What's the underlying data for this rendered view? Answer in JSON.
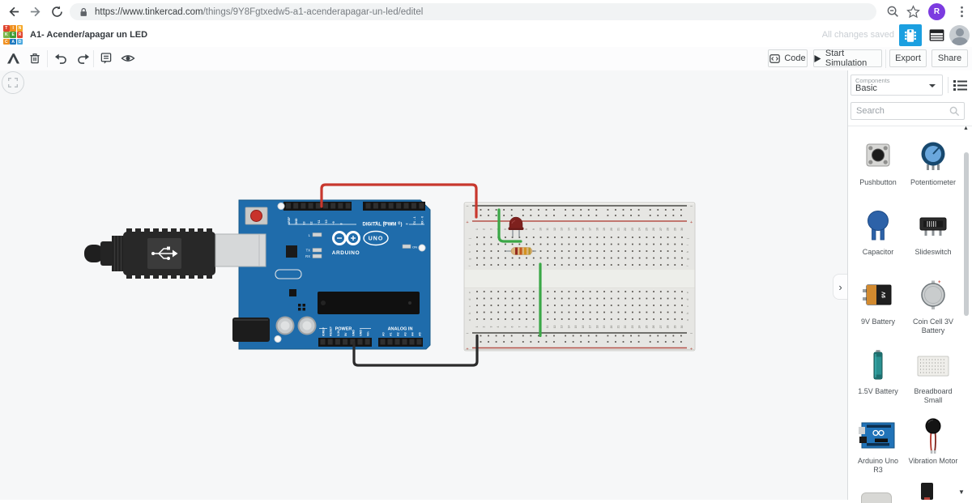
{
  "browser": {
    "url_domain": "https://www.tinkercad.com",
    "url_path": "/things/9Y8Fgtxedw5-a1-acenderapagar-un-led/editel",
    "avatar_letter": "R"
  },
  "header": {
    "logo_letters": [
      "T",
      "I",
      "N",
      "K",
      "E",
      "R",
      "C",
      "A",
      "D"
    ],
    "logo_colors": [
      "#e0452f",
      "#f09020",
      "#f5a623",
      "#7ab648",
      "#3f9c35",
      "#e0452f",
      "#f09020",
      "#1d78be",
      "#4aa8df"
    ],
    "title": "A1- Acender/apagar un LED",
    "save_status": "All changes saved"
  },
  "toolbar": {
    "code": "Code",
    "start_simulation": "Start Simulation",
    "export": "Export",
    "share": "Share"
  },
  "sidebar": {
    "components_label": "Components",
    "category": "Basic",
    "search_placeholder": "Search",
    "components": [
      {
        "label": "Pushbutton"
      },
      {
        "label": "Potentiometer"
      },
      {
        "label": "Capacitor"
      },
      {
        "label": "Slideswitch"
      },
      {
        "label": "9V Battery",
        "icon_text": "9V"
      },
      {
        "label": "Coin Cell 3V Battery"
      },
      {
        "label": "1.5V Battery"
      },
      {
        "label": "Breadboard Small"
      },
      {
        "label": "Arduino Uno R3"
      },
      {
        "label": "Vibration Motor"
      }
    ]
  },
  "circuit": {
    "arduino": {
      "brand": "ARDUINO",
      "model": "UNO",
      "digital_label": "DIGITAL (PWM ~)",
      "digital_pins_left": [
        "AREF",
        "GND",
        "13",
        "12",
        "~11",
        "~10",
        "~9",
        "8"
      ],
      "digital_pins_right": [
        "7",
        "~6",
        "~5",
        "4",
        "~3",
        "2",
        "TX→1",
        "RX←0"
      ],
      "power_label": "POWER",
      "power_pins": [
        "IOREF",
        "RESET",
        "3.3V",
        "5V",
        "GND",
        "GND",
        "Vin"
      ],
      "analog_label": "ANALOG IN",
      "analog_pins": [
        "A0",
        "A1",
        "A2",
        "A3",
        "A4",
        "A5"
      ],
      "led_labels": [
        "L",
        "TX",
        "RX"
      ],
      "on_label": "ON"
    },
    "breadboard": {
      "row_labels_upper": [
        "j",
        "i",
        "h",
        "g",
        "f"
      ],
      "row_labels_lower": [
        "e",
        "d",
        "c",
        "b",
        "a"
      ],
      "column_count": 30,
      "minus": "−",
      "plus": "+"
    },
    "colors": {
      "wire_red": "#c8382e",
      "wire_black": "#2b2b2b",
      "wire_green": "#3aa746",
      "board_blue": "#1f6cab",
      "led_body": "#7e211e",
      "resistor_body": "#d9b37a"
    }
  }
}
